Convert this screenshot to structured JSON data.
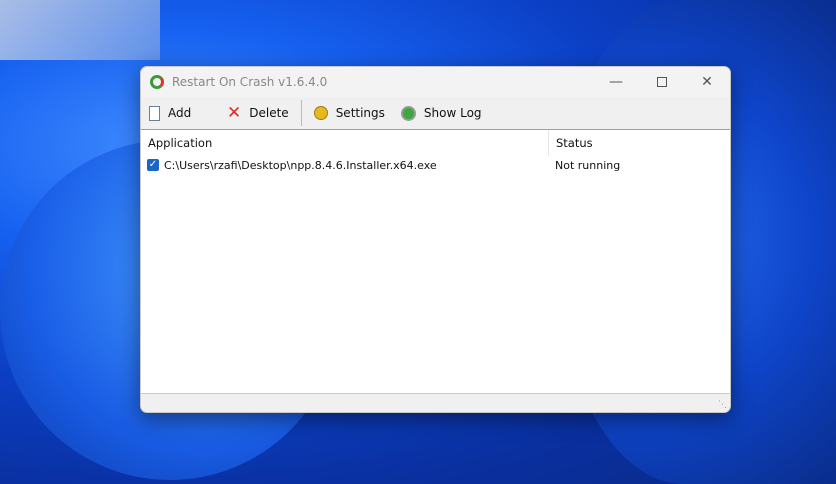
{
  "window": {
    "title": "Restart On Crash v1.6.4.0"
  },
  "toolbar": {
    "add": "Add",
    "delete": "Delete",
    "settings": "Settings",
    "show_log": "Show Log"
  },
  "list": {
    "columns": [
      "Application",
      "Status"
    ],
    "rows": [
      {
        "checked": true,
        "application": "C:\\Users\\rzafi\\Desktop\\npp.8.4.6.Installer.x64.exe",
        "status": "Not running"
      }
    ]
  }
}
